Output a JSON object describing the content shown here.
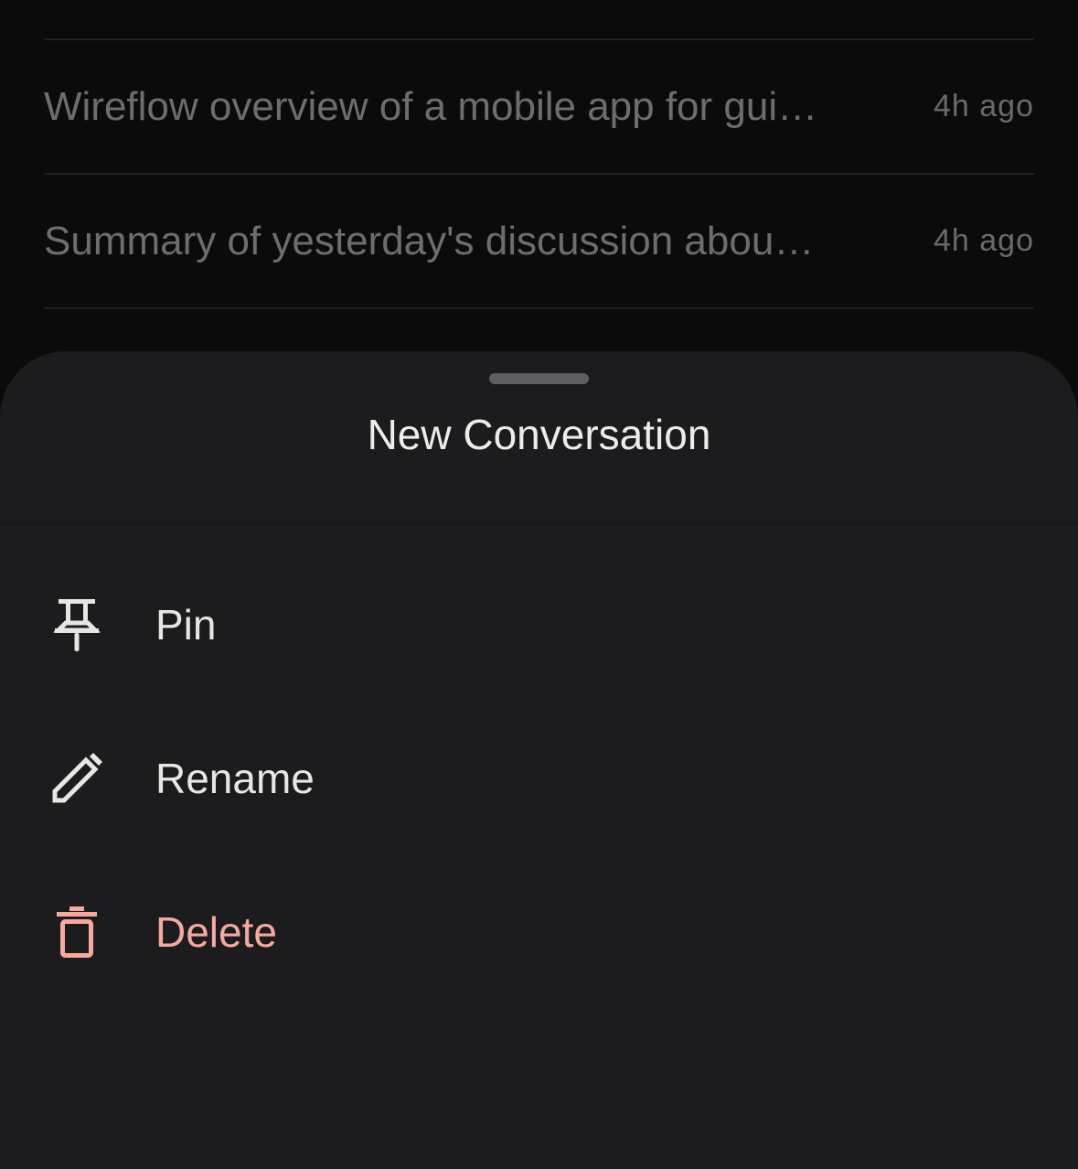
{
  "conversations": [
    {
      "title": "Wireflow overview of a mobile app for gui…",
      "time": "4h ago"
    },
    {
      "title": "Summary of yesterday's discussion abou…",
      "time": "4h ago"
    }
  ],
  "sheet": {
    "title": "New Conversation",
    "items": [
      {
        "label": "Pin",
        "icon": "pin-icon"
      },
      {
        "label": "Rename",
        "icon": "pencil-icon"
      },
      {
        "label": "Delete",
        "icon": "trash-icon",
        "color": "#f4a9a1"
      }
    ]
  },
  "colors": {
    "background": "#0b0b0b",
    "sheet": "#1c1c1e",
    "danger": "#f4a9a1"
  }
}
